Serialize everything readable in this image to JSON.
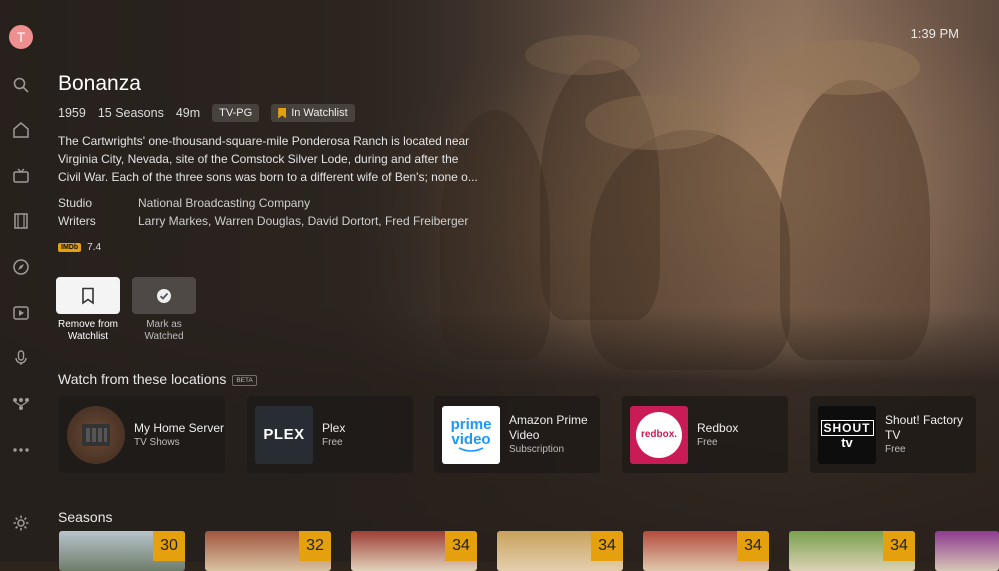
{
  "app": {
    "clock": "1:39 PM",
    "avatar_initial": "T"
  },
  "sidebar": {
    "icons": [
      "search-icon",
      "home-icon",
      "tv-icon",
      "film-icon",
      "compass-icon",
      "play-icon",
      "microphone-icon",
      "network-icon",
      "more-icon",
      "settings-icon"
    ]
  },
  "show": {
    "title": "Bonanza",
    "year": "1959",
    "seasons": "15 Seasons",
    "runtime": "49m",
    "rating": "TV-PG",
    "watchlist_badge": "In Watchlist",
    "summary": "The Cartwrights' one-thousand-square-mile Ponderosa Ranch is located near Virginia City, Nevada, site of the Comstock Silver Lode, during and after the Civil War. Each of the three sons was born to a different wife of Ben's; none o...",
    "studio_label": "Studio",
    "studio": "National Broadcasting Company",
    "writers_label": "Writers",
    "writers": "Larry Markes, Warren Douglas, David Dortort, Fred Freiberger",
    "imdb_label": "IMDb",
    "imdb_score": "7.4"
  },
  "actions": {
    "remove_watchlist": "Remove from Watchlist",
    "mark_watched": "Mark as Watched"
  },
  "locations": {
    "title": "Watch from these locations",
    "beta": "BETA",
    "items": [
      {
        "name": "My Home Server",
        "sub": "TV Shows"
      },
      {
        "name": "Plex",
        "sub": "Free",
        "logo": "PLEX"
      },
      {
        "name": "Amazon Prime Video",
        "sub": "Subscription",
        "logo_line1": "prime",
        "logo_line2": "video"
      },
      {
        "name": "Redbox",
        "sub": "Free",
        "logo": "redbox."
      },
      {
        "name": "Shout! Factory TV",
        "sub": "Free",
        "logo_line1": "SHOUT",
        "logo_line2": "tv"
      }
    ]
  },
  "seasons_section": {
    "title": "Seasons",
    "items": [
      {
        "count": "30"
      },
      {
        "count": "32"
      },
      {
        "count": "34"
      },
      {
        "count": "34"
      },
      {
        "count": "34"
      },
      {
        "count": "34"
      },
      {
        "count": ""
      }
    ]
  },
  "colors": {
    "accent": "#e5a00d",
    "avatar": "#f08f8f",
    "redbox": "#c91b56",
    "plex_bg": "#282c33"
  }
}
